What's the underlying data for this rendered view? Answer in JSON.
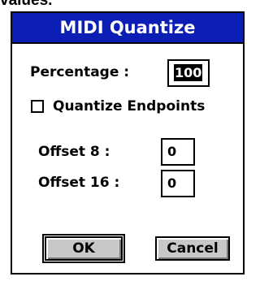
{
  "top_text": "values.",
  "dialog": {
    "title": "MIDI Quantize",
    "percentage_label": "Percentage :",
    "percentage_value": "100",
    "quantize_endpoints_label": "Quantize Endpoints",
    "quantize_endpoints_checked": false,
    "offset8_label": "Offset 8   :",
    "offset8_value": "0",
    "offset16_label": "Offset 16 :",
    "offset16_value": "0",
    "ok_label": "OK",
    "cancel_label": "Cancel"
  },
  "colors": {
    "titlebar": "#0b1fb5",
    "button_face": "#c8c8c8"
  }
}
